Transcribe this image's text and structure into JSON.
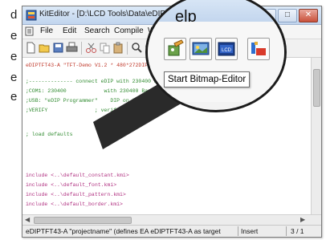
{
  "side_text": [
    "d",
    "e",
    "e",
    "e",
    "e"
  ],
  "window": {
    "title": "KitEditor - [D:\\LCD Tools\\Data\\eDIP",
    "buttons": {
      "minimize": "–",
      "maximize": "□",
      "close": "✕"
    }
  },
  "menu": [
    "File",
    "Edit",
    "Search",
    "Compile",
    "W"
  ],
  "toolbar": {
    "icons": [
      "new-file-icon",
      "open-folder-icon",
      "save-icon",
      "print-icon",
      "cut-icon",
      "copy-icon",
      "paste-icon",
      "search-icon",
      "find-next-icon"
    ]
  },
  "magnified": {
    "title_fragment": "elp",
    "icons": [
      "bitmap-editor-icon",
      "image-viewer-icon",
      "lcd-simulator-icon",
      "font-editor-icon"
    ],
    "icon_labels": {
      "lcd": "LCD"
    }
  },
  "tooltip": "Start Bitmap-Editor",
  "code": {
    "header_line": "eDIPTFT43-A \"TFT-Demo V1.2 * 480*272DIP",
    "lines": [
      ";-------------- connect eDIP with 230400 Baud",
      ";COM1: 230400            with 230400 Baud",
      ";USB: \"eDIP Programmer\"    DIP on COM1",
      ";VERIFY               ; verify after write",
      "",
      "; load defaults",
      "",
      "include <..\\default_constant.kmi>",
      "include <..\\default_font.kmi>",
      "include <..\\default_pattern.kmi>",
      "include <..\\default_border.kmi>"
    ]
  },
  "statusbar": {
    "message": "eDIPTFT43-A  \"projectname\" (defines EA eDIPTFT43-A as target",
    "mode": "Insert",
    "position": "3 / 1"
  }
}
